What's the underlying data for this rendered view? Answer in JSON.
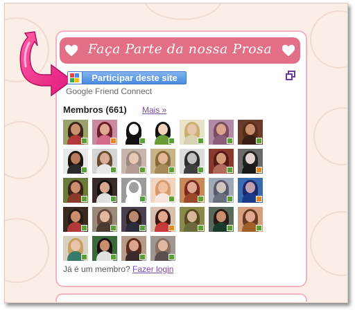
{
  "banner": {
    "title": "Faça Parte da nossa Prosa",
    "heart_icon": "heart-icon",
    "color": "#e36f86"
  },
  "join": {
    "button_label": "Participar deste site",
    "provider": "Google Friend Connect",
    "popout_icon": "popout-window-icon"
  },
  "members": {
    "title": "Membros (661)",
    "more_label": "Mais »",
    "avatars": [
      {
        "skin": "#c98f6e",
        "hair": "#3a2418",
        "bg": "#9aa16b",
        "body": "#b03a3a",
        "badge": "#5c9e3b"
      },
      {
        "skin": "#e0a890",
        "hair": "#6b1e2a",
        "bg": "#c98aa0",
        "body": "#d46b8d",
        "badge": "#e08a2c"
      },
      {
        "skin": "#ffffff",
        "hair": "#111111",
        "bg": "#ffffff",
        "body": "#111111",
        "badge": "#5c9e3b"
      },
      {
        "skin": "#f2d2b8",
        "hair": "#111111",
        "bg": "#ffffff",
        "body": "#6a9a3a",
        "badge": "#5c9e3b"
      },
      {
        "skin": "#e8c4a8",
        "hair": "#c9b071",
        "bg": "#e7e2c8",
        "body": "#d9d2b0",
        "badge": "#5c9e3b"
      },
      {
        "skin": "#d9a58f",
        "hair": "#7a4b5e",
        "bg": "#b28aa8",
        "body": "#8c5d7a",
        "badge": "#5c9e3b"
      },
      {
        "skin": "#c98f6e",
        "hair": "#5a2c18",
        "bg": "#6b3c2a",
        "body": "#3a1e14",
        "badge": "#5c9e3b"
      },
      {
        "skin": "#b87a5e",
        "hair": "#1e1410",
        "bg": "#e8e8e8",
        "body": "#2a2a2a",
        "badge": "#5c9e3b"
      },
      {
        "skin": "#d8ad93",
        "hair": "#6b4a32",
        "bg": "#d4d4d4",
        "body": "#e8e8e8",
        "badge": "#5c9e3b"
      },
      {
        "skin": "#e8c8b4",
        "hair": "#9a8a80",
        "bg": "#c9b5ad",
        "body": "#b59c94",
        "badge": "#5c9e3b"
      },
      {
        "skin": "#e0b896",
        "hair": "#8a6a3a",
        "bg": "#c8b28a",
        "body": "#a88a5a",
        "badge": "#5c9e3b"
      },
      {
        "skin": "#c0c0c0",
        "hair": "#303030",
        "bg": "#dcdcdc",
        "body": "#404040",
        "badge": "#5c9e3b"
      },
      {
        "skin": "#d59c7c",
        "hair": "#5a1a14",
        "bg": "#8a3a2a",
        "body": "#b06a5a",
        "badge": "#5c9e3b"
      },
      {
        "skin": "#e0d4d0",
        "hair": "#222222",
        "bg": "#6a6a6a",
        "body": "#1a1a1a",
        "badge": "#e08a2c"
      },
      {
        "skin": "#c98f6e",
        "hair": "#3a2418",
        "bg": "#6a7a3a",
        "body": "#8a3a2a",
        "badge": "#5c9e3b"
      },
      {
        "skin": "#d9a58f",
        "hair": "#111111",
        "bg": "#3a2a2a",
        "body": "#e0e0e0",
        "badge": "#5c9e3b"
      },
      {
        "skin": "#a0a0a0",
        "hair": "#ffffff",
        "bg": "#9a9a9a",
        "body": "#ffffff",
        "badge": "#5c9e3b"
      },
      {
        "skin": "#f0c0a0",
        "hair": "#d89a70",
        "bg": "#f3d4c0",
        "body": "#f7e6dc",
        "badge": "#5c9e3b"
      },
      {
        "skin": "#e0a890",
        "hair": "#7a2a1e",
        "bg": "#c88a5a",
        "body": "#9a4a2a",
        "badge": "#5c9e3b"
      },
      {
        "skin": "#d0c4c0",
        "hair": "#5a5a6a",
        "bg": "#a0a8b8",
        "body": "#6a7080",
        "badge": "#5c9e3b"
      },
      {
        "skin": "#c0a0b0",
        "hair": "#1a2a6a",
        "bg": "#3a6ab0",
        "body": "#1a3a8a",
        "badge": "#e08a2c"
      },
      {
        "skin": "#c98f6e",
        "hair": "#2a1a14",
        "bg": "#3a2a22",
        "body": "#b03a3a",
        "badge": "#5c9e3b"
      },
      {
        "skin": "#e0b8a0",
        "hair": "#6a4a3a",
        "bg": "#9a8a7a",
        "body": "#4a3a30",
        "badge": "#5c9e3b"
      },
      {
        "skin": "#b88a70",
        "hair": "#2a1a14",
        "bg": "#4a4050",
        "body": "#2a2a3a",
        "badge": "#5c9e3b"
      },
      {
        "skin": "#e0a890",
        "hair": "#3a1a10",
        "bg": "#d8c0b0",
        "body": "#c83a3a",
        "badge": "#e08a2c"
      },
      {
        "skin": "#d9b89a",
        "hair": "#5a4a20",
        "bg": "#8a8a4a",
        "body": "#6a6a3a",
        "badge": "#5c9e3b"
      },
      {
        "skin": "#c98f6e",
        "hair": "#2a1a14",
        "bg": "#5a6a5a",
        "body": "#1a3a2a",
        "badge": "#5c9e3b"
      },
      {
        "skin": "#e0a890",
        "hair": "#6a3a1e",
        "bg": "#d4a080",
        "body": "#a0602a",
        "badge": "#5c9e3b"
      },
      {
        "skin": "#e8c4a8",
        "hair": "#c8a060",
        "bg": "#d8d0c0",
        "body": "#3a7a6a",
        "badge": "#5c9e3b"
      },
      {
        "skin": "#c98f6e",
        "hair": "#1a1010",
        "bg": "#3a6a3a",
        "body": "#e0e0e0",
        "badge": "#5c9e3b"
      },
      {
        "skin": "#d9a58f",
        "hair": "#5a2a1a",
        "bg": "#b89a8a",
        "body": "#3a2a2a",
        "badge": "#5c9e3b"
      },
      {
        "skin": "#e0b8a0",
        "hair": "#8a7060",
        "bg": "#a09890",
        "body": "#5a5050",
        "badge": "#5c9e3b"
      }
    ]
  },
  "footer": {
    "prompt": "Já é um membro?",
    "login_label": "Fazer login"
  },
  "decor": {
    "arrow_icon": "pink-arrow-icon"
  }
}
